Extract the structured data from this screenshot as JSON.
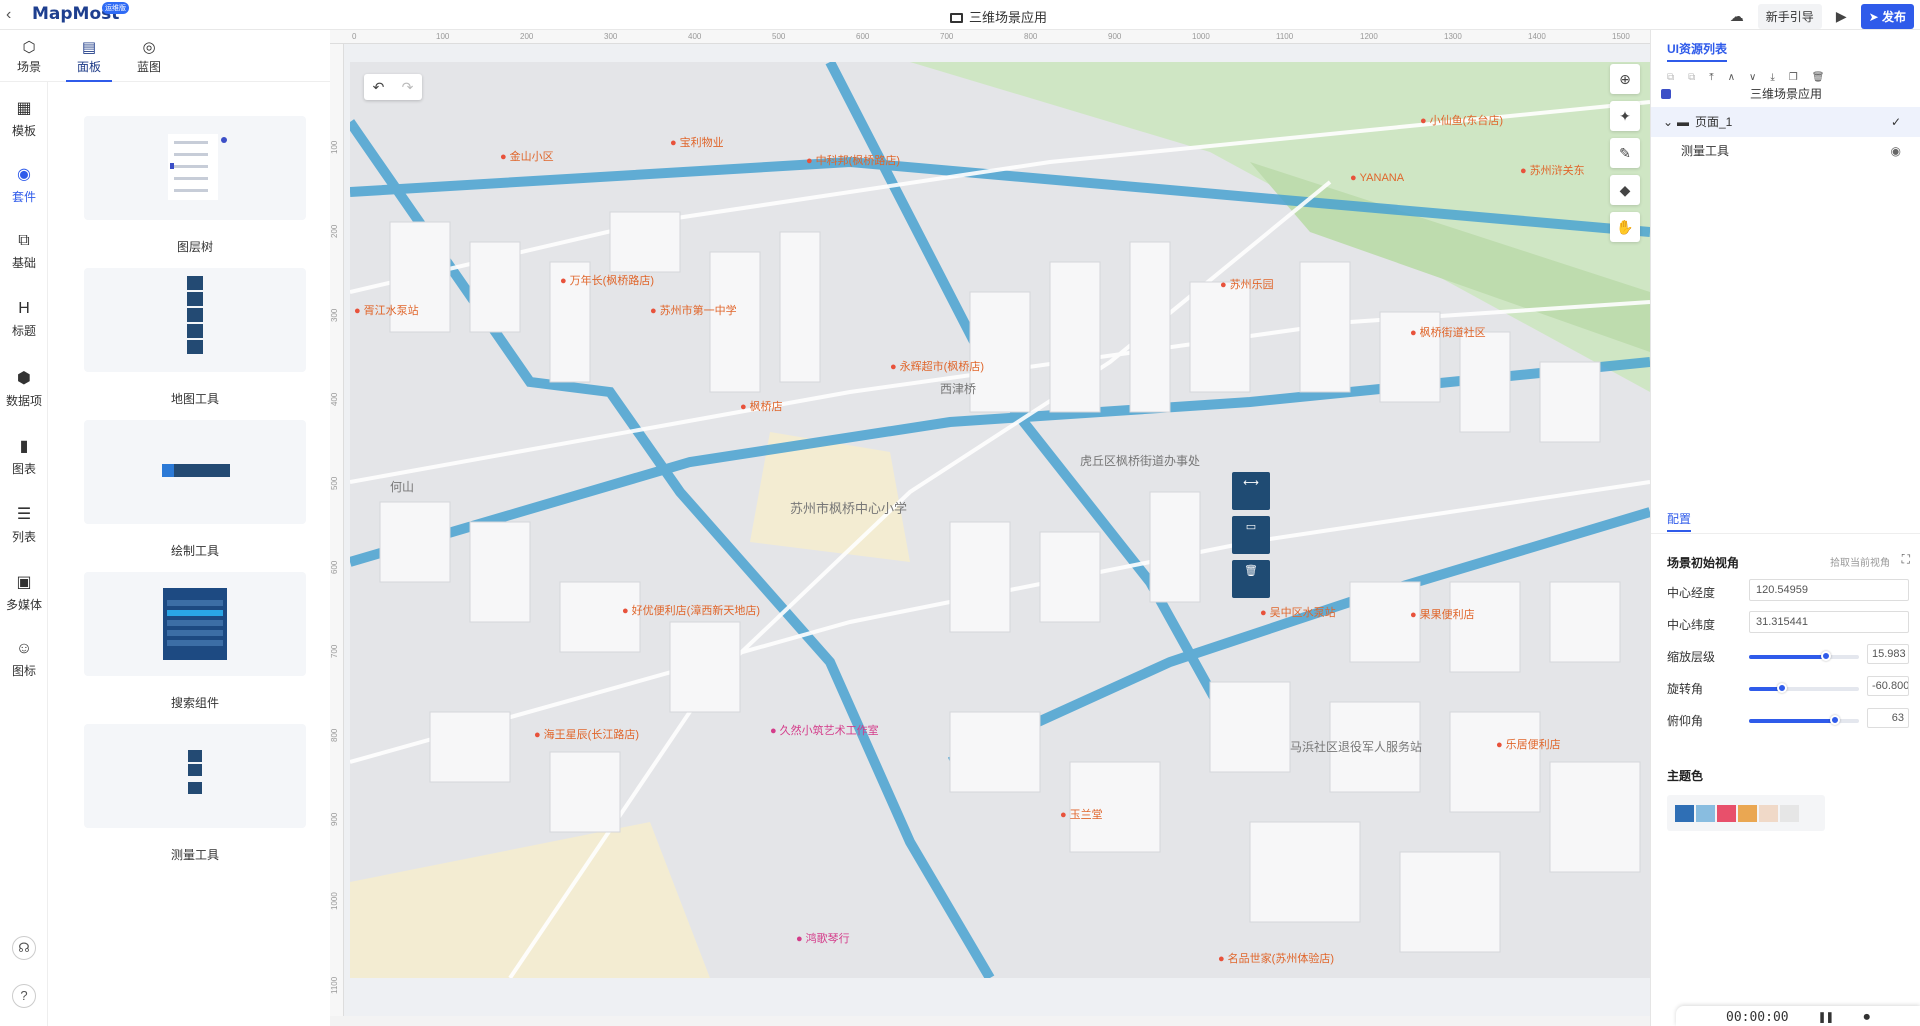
{
  "header": {
    "app_title": "三维场景应用",
    "logo_text": "MapMost",
    "beta_badge": "运维版",
    "guide_label": "新手引导",
    "publish_label": "发布"
  },
  "top_tabs": [
    {
      "label": "场景",
      "icon": "scene-icon"
    },
    {
      "label": "面板",
      "icon": "panel-icon"
    },
    {
      "label": "蓝图",
      "icon": "blueprint-icon"
    }
  ],
  "rail": [
    {
      "label": "模板",
      "icon": "template-icon"
    },
    {
      "label": "套件",
      "icon": "kit-icon"
    },
    {
      "label": "基础",
      "icon": "basic-icon"
    },
    {
      "label": "标题",
      "icon": "heading-icon"
    },
    {
      "label": "数据项",
      "icon": "data-item-icon"
    },
    {
      "label": "图表",
      "icon": "chart-icon"
    },
    {
      "label": "列表",
      "icon": "list-icon"
    },
    {
      "label": "多媒体",
      "icon": "media-icon"
    },
    {
      "label": "图标",
      "icon": "emoji-icon"
    }
  ],
  "kits": [
    {
      "label": "图层树"
    },
    {
      "label": "地图工具"
    },
    {
      "label": "绘制工具"
    },
    {
      "label": "搜索组件"
    },
    {
      "label": "测量工具"
    }
  ],
  "ruler": {
    "top_ticks": [
      "0",
      "100",
      "200",
      "300",
      "400",
      "500",
      "600",
      "700",
      "800",
      "900",
      "1000",
      "1100",
      "1200",
      "1300",
      "1400",
      "1500"
    ],
    "left_ticks": [
      "100",
      "200",
      "300",
      "400",
      "500",
      "600",
      "700",
      "800",
      "900",
      "1000",
      "1100"
    ]
  },
  "map": {
    "pois": [
      "金山小区",
      "宝利物业",
      "中科邦(枫桥路店)",
      "万年长(枫桥路店)",
      "苏州市第一中学",
      "枫桥街道社区",
      "苏州乐园",
      "胥江水泵站",
      "小仙鱼(东台店)",
      "YANANA",
      "苏州浒关东",
      "永辉超市(枫桥店)",
      "苏州市枫桥中心小学",
      "好优便利店(漳西新天地店)",
      "久然小筑艺术工作室",
      "玉兰堂",
      "鸿歌琴行",
      "名品世家(苏州体验店)",
      "乐居便利店",
      "海王星辰(长江路店)",
      "枫桥店",
      "吴中区水泵站",
      "果果便利店"
    ],
    "places": [
      "虎丘区枫桥街道办事处",
      "西津桥",
      "马浜社区退役军人服务站",
      "苏州市枫桥中心小学",
      "何山"
    ]
  },
  "right_panel": {
    "title": "UI资源列表",
    "tree": [
      {
        "label": "三维场景应用"
      },
      {
        "label": "页面_1"
      },
      {
        "label": "测量工具"
      }
    ],
    "config_tab": "配置",
    "scene_view_title": "场景初始视角",
    "pick_view_label": "拾取当前视角",
    "center_lng_label": "中心经度",
    "center_lng": "120.54959",
    "center_lat_label": "中心纬度",
    "center_lat": "31.315441",
    "zoom_label": "缩放层级",
    "zoom": "15.983",
    "zoom_fraction": 0.7,
    "rotate_label": "旋转角",
    "rotate": "-60.800(",
    "rotate_fraction": 0.3,
    "pitch_label": "俯仰角",
    "pitch": "63",
    "pitch_fraction": 0.78,
    "theme_color_label": "主题色",
    "theme_colors": [
      "#2f6fb5",
      "#89bde0",
      "#e8506b",
      "#eaa752",
      "#f0d9c8",
      "#e6e6e6"
    ]
  },
  "timer": {
    "time": "00:00:00",
    "pause_icon": "pause-icon",
    "record_icon": "record-icon"
  }
}
